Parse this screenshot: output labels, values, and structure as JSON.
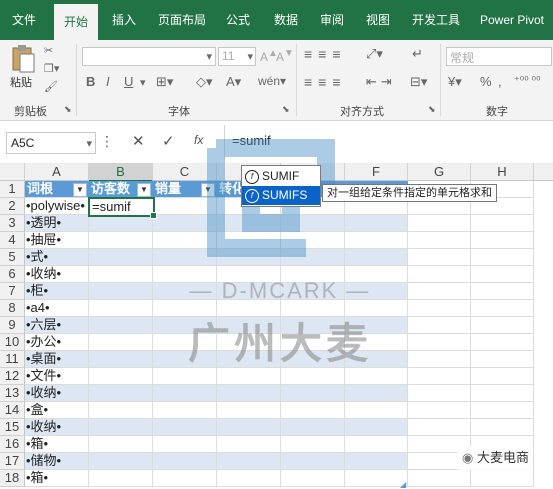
{
  "ribbon_tabs": [
    "文件",
    "开始",
    "插入",
    "页面布局",
    "公式",
    "数据",
    "审阅",
    "视图",
    "开发工具",
    "Power Pivot"
  ],
  "active_tab": "开始",
  "clipboard": {
    "paste_label": "粘贴",
    "group_label": "剪贴板"
  },
  "font": {
    "font_size": "11",
    "group_label": "字体",
    "bold": "B",
    "italic": "I",
    "underline": "U"
  },
  "alignment": {
    "group_label": "对齐方式"
  },
  "number": {
    "format_value": "常规",
    "group_label": "数字",
    "percent": "%"
  },
  "formula_bar": {
    "name_box": "A5C",
    "formula": "=sumif",
    "fx_label": "fx"
  },
  "columns": [
    "A",
    "B",
    "C",
    "D",
    "E",
    "F",
    "G",
    "H"
  ],
  "header_row": {
    "row": "1",
    "a": "词根",
    "b": "访客数",
    "c": "销量",
    "d": "转化"
  },
  "rows": [
    {
      "row": "2",
      "a": "•polywise•",
      "b": "=sumif"
    },
    {
      "row": "3",
      "a": "•透明•"
    },
    {
      "row": "4",
      "a": "•抽屉•"
    },
    {
      "row": "5",
      "a": "•式•"
    },
    {
      "row": "6",
      "a": "•收纳•"
    },
    {
      "row": "7",
      "a": "•柜•"
    },
    {
      "row": "8",
      "a": "•a4•"
    },
    {
      "row": "9",
      "a": "•六层•"
    },
    {
      "row": "10",
      "a": "•办公•"
    },
    {
      "row": "11",
      "a": "•桌面•"
    },
    {
      "row": "12",
      "a": "•文件•"
    },
    {
      "row": "13",
      "a": "•收纳•"
    },
    {
      "row": "14",
      "a": "•盒•"
    },
    {
      "row": "15",
      "a": "•收纳•"
    },
    {
      "row": "16",
      "a": "•箱•"
    },
    {
      "row": "17",
      "a": "•储物•"
    },
    {
      "row": "18",
      "a": "•箱•"
    }
  ],
  "autocomplete": {
    "items": [
      "SUMIF",
      "SUMIFS"
    ],
    "selected": "SUMIFS",
    "tooltip": "对一组给定条件指定的单元格求和"
  },
  "watermark": {
    "brand": "— D-MCARK —",
    "name_cn": "广州大麦",
    "wechat": "大麦电商"
  },
  "colors": {
    "excel_green": "#217346",
    "table_header": "#5b9bd5",
    "band": "#dde7f3",
    "selection": "#0a64c8"
  }
}
